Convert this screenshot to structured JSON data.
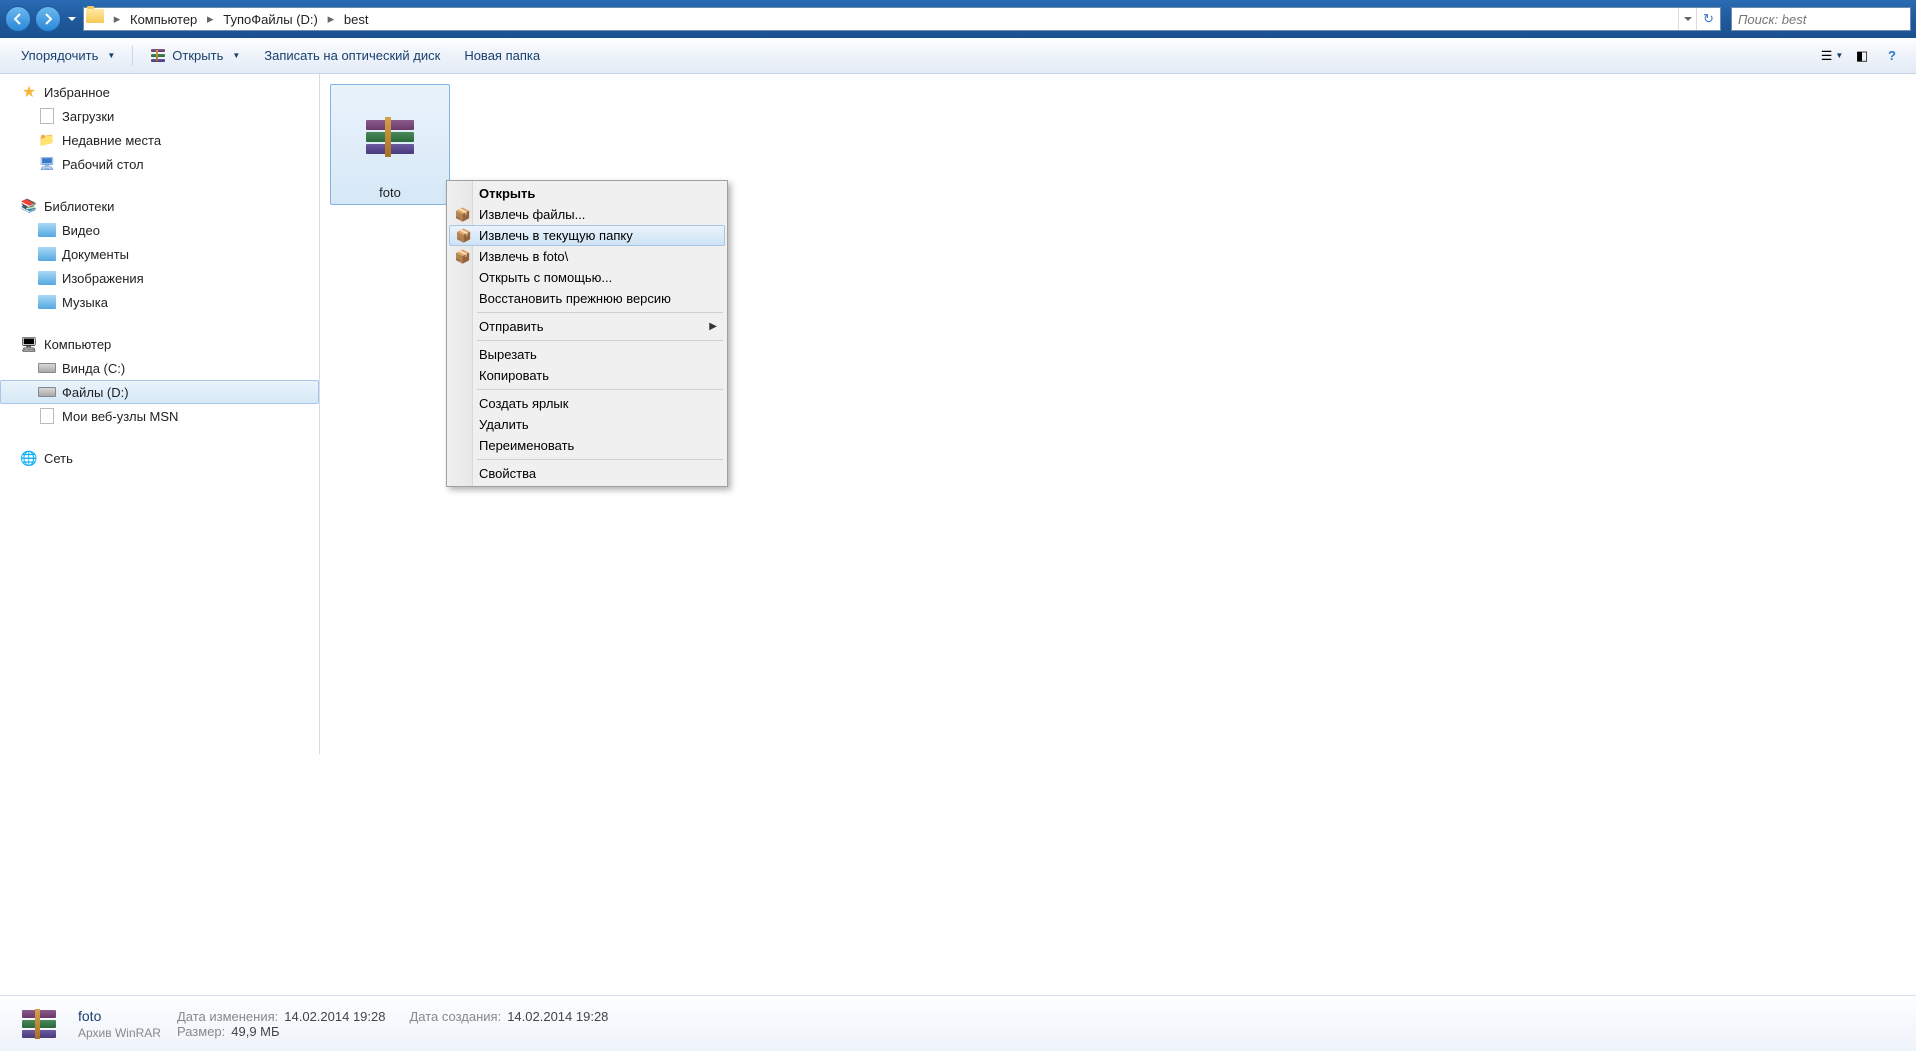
{
  "breadcrumb": {
    "parts": [
      "Компьютер",
      "ТупоФайлы (D:)",
      "best"
    ]
  },
  "search": {
    "placeholder": "Поиск: best"
  },
  "toolbar": {
    "organize": "Упорядочить",
    "open": "Открыть",
    "burn": "Записать на оптический диск",
    "new_folder": "Новая папка"
  },
  "sidebar": {
    "favorites": {
      "label": "Избранное",
      "items": [
        "Загрузки",
        "Недавние места",
        "Рабочий стол"
      ]
    },
    "libraries": {
      "label": "Библиотеки",
      "items": [
        "Видео",
        "Документы",
        "Изображения",
        "Музыка"
      ]
    },
    "computer": {
      "label": "Компьютер",
      "items": [
        "Винда (C:)",
        "Файлы (D:)",
        "Мои веб-узлы MSN"
      ]
    },
    "network": {
      "label": "Сеть"
    }
  },
  "file": {
    "name": "foto"
  },
  "context_menu": {
    "open": "Открыть",
    "extract_files": "Извлечь файлы...",
    "extract_here": "Извлечь в текущую папку",
    "extract_to": "Извлечь в foto\\",
    "open_with": "Открыть с помощью...",
    "restore_prev": "Восстановить прежнюю версию",
    "send_to": "Отправить",
    "cut": "Вырезать",
    "copy": "Копировать",
    "create_shortcut": "Создать ярлык",
    "delete": "Удалить",
    "rename": "Переименовать",
    "properties": "Свойства"
  },
  "details": {
    "name": "foto",
    "type": "Архив WinRAR",
    "mod_label": "Дата изменения:",
    "mod_value": "14.02.2014 19:28",
    "size_label": "Размер:",
    "size_value": "49,9 МБ",
    "created_label": "Дата создания:",
    "created_value": "14.02.2014 19:28"
  }
}
